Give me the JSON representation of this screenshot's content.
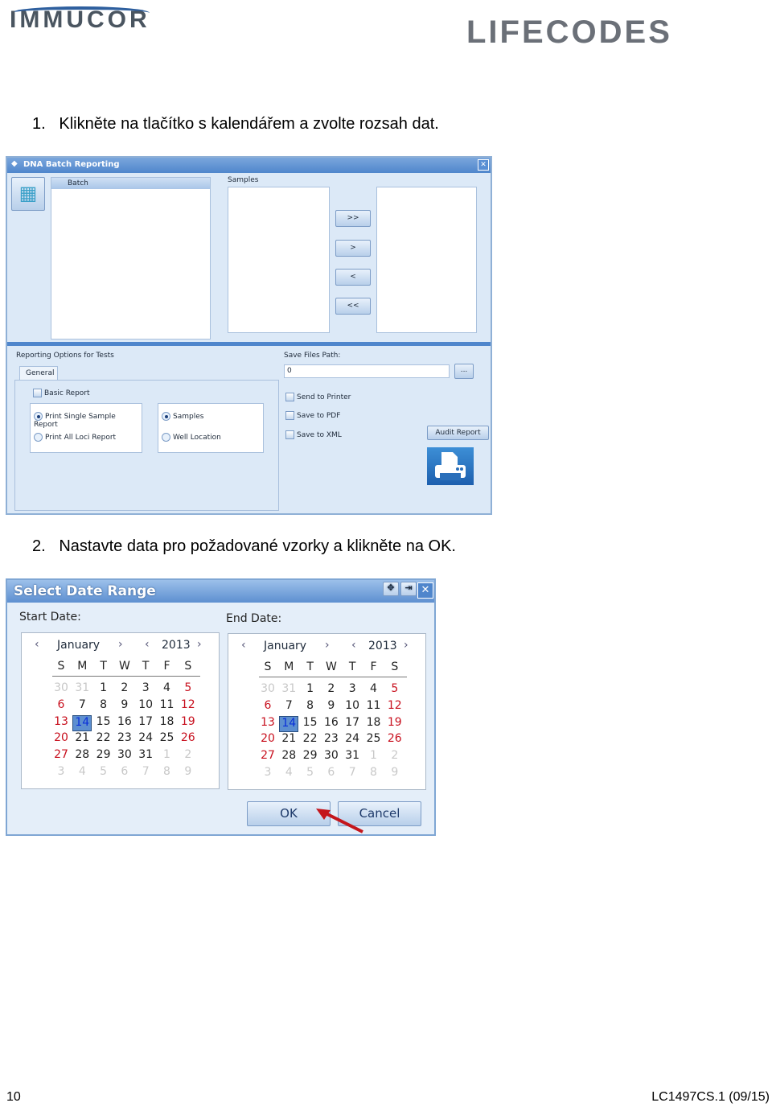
{
  "header": {
    "logo_left": "IMMUCOR",
    "logo_right": "LIFECODES"
  },
  "steps": [
    {
      "number": "1.",
      "text": "Klikněte na tlačítko s kalendářem a zvolte rozsah dat."
    },
    {
      "number": "2.",
      "text": "Nastavte data pro požadované vzorky a klikněte na OK."
    }
  ],
  "batch_dialog": {
    "title": "DNA Batch Reporting",
    "batch_header": "Batch",
    "samples_label": "Samples",
    "move_buttons": [
      ">>",
      ">",
      "<",
      "<<"
    ],
    "reporting_label": "Reporting Options for Tests",
    "tab": "General",
    "basic_report": "Basic Report",
    "radio_group1": [
      {
        "label": "Print Single Sample Report",
        "checked": true
      },
      {
        "label": "Print All Loci Report",
        "checked": false
      }
    ],
    "radio_group2": [
      {
        "label": "Samples",
        "checked": true
      },
      {
        "label": "Well Location",
        "checked": false
      }
    ],
    "save_path_label": "Save Files Path:",
    "save_path_value": "0",
    "browse_button": "...",
    "outputs": [
      "Send to Printer",
      "Save to PDF",
      "Save to XML"
    ],
    "audit_button": "Audit Report"
  },
  "date_dialog": {
    "title": "Select Date Range",
    "weekdays": [
      "S",
      "M",
      "T",
      "W",
      "T",
      "F",
      "S"
    ],
    "calendars": [
      {
        "label": "Start Date:",
        "month": "January",
        "year": "2013",
        "selected": 14,
        "weeks": [
          [
            30,
            31,
            1,
            2,
            3,
            4,
            5
          ],
          [
            6,
            7,
            8,
            9,
            10,
            11,
            12
          ],
          [
            13,
            14,
            15,
            16,
            17,
            18,
            19
          ],
          [
            20,
            21,
            22,
            23,
            24,
            25,
            26
          ],
          [
            27,
            28,
            29,
            30,
            31,
            1,
            2
          ],
          [
            3,
            4,
            5,
            6,
            7,
            8,
            9
          ]
        ]
      },
      {
        "label": "End Date:",
        "month": "January",
        "year": "2013",
        "selected": 14,
        "weeks": [
          [
            30,
            31,
            1,
            2,
            3,
            4,
            5
          ],
          [
            6,
            7,
            8,
            9,
            10,
            11,
            12
          ],
          [
            13,
            14,
            15,
            16,
            17,
            18,
            19
          ],
          [
            20,
            21,
            22,
            23,
            24,
            25,
            26
          ],
          [
            27,
            28,
            29,
            30,
            31,
            1,
            2
          ],
          [
            3,
            4,
            5,
            6,
            7,
            8,
            9
          ]
        ]
      }
    ],
    "ok_button": "OK",
    "cancel_button": "Cancel"
  },
  "colors": {
    "accent": "#5d8fd0",
    "weekend": "#c8101e",
    "arrow": "#c4161c"
  },
  "footer": {
    "page": "10",
    "doc_code": "LC1497CS.1 (09/15)"
  }
}
